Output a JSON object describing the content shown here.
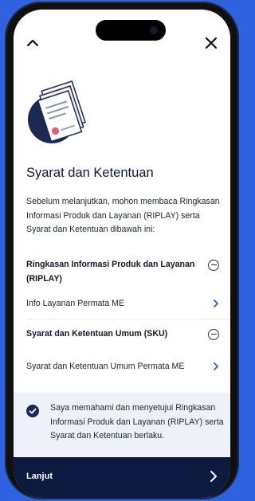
{
  "icons": {
    "back": "chevron-up-icon",
    "close": "close-icon",
    "document": "document-illustration",
    "section_toggle": "minus-circle-icon",
    "link": "chevron-right-icon",
    "checkbox": "checkmark-icon",
    "continue": "chevron-right-icon"
  },
  "colors": {
    "background": "#2e62e0",
    "navy": "#0c1a3f",
    "link_chevron": "#2d5bd8",
    "consent_bg": "#eef1f8"
  },
  "page": {
    "title": "Syarat dan Ketentuan",
    "intro": "Sebelum melanjutkan, mohon membaca Ringkasan Informasi Produk dan Layanan (RIPLAY) serta Syarat dan Ketentuan dibawah ini:"
  },
  "sections": [
    {
      "title": "Ringkasan Informasi Produk dan Layanan (RIPLAY)",
      "link": "Info Layanan Permata ME"
    },
    {
      "title": "Syarat dan Ketentuan Umum (SKU)",
      "link": "Syarat dan Ketentuan Umum Permata ME"
    }
  ],
  "consent": {
    "checked": true,
    "text": "Saya memahami dan menyetujui Ringkasan Informasi Produk dan Layanan (RIPLAY) serta Syarat dan Ketentuan berlaku."
  },
  "footer": {
    "button_label": "Lanjut"
  }
}
